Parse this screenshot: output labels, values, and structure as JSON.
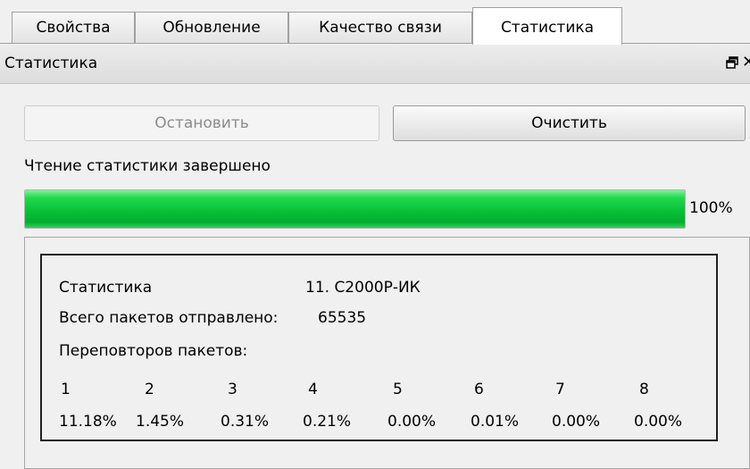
{
  "tabs": [
    {
      "label": "Свойства",
      "active": false
    },
    {
      "label": "Обновление",
      "active": false
    },
    {
      "label": "Качество связи",
      "active": false
    },
    {
      "label": "Статистика",
      "active": true
    }
  ],
  "dock": {
    "title": "Статистика",
    "icons": [
      "float-icon",
      "close-icon"
    ],
    "close_glyph": "✕"
  },
  "buttons": {
    "stop_label": "Остановить",
    "stop_enabled": false,
    "clear_label": "Очистить"
  },
  "status_text": "Чтение статистики завершено",
  "progress": {
    "value_percent": 100,
    "text": "100%",
    "bar_color": "#07c137"
  },
  "stats": {
    "title_label": "Статистика",
    "device": "11. С2000Р-ИК",
    "packets_sent_label": "Всего пакетов отправлено:",
    "packets_sent_value": "65535",
    "retries_label": "Переповторов пакетов:",
    "retry_columns": [
      "1",
      "2",
      "3",
      "4",
      "5",
      "6",
      "7",
      "8"
    ],
    "retry_values": [
      "11.18%",
      "1.45%",
      "0.31%",
      "0.21%",
      "0.00%",
      "0.01%",
      "0.00%",
      "0.00%"
    ]
  }
}
